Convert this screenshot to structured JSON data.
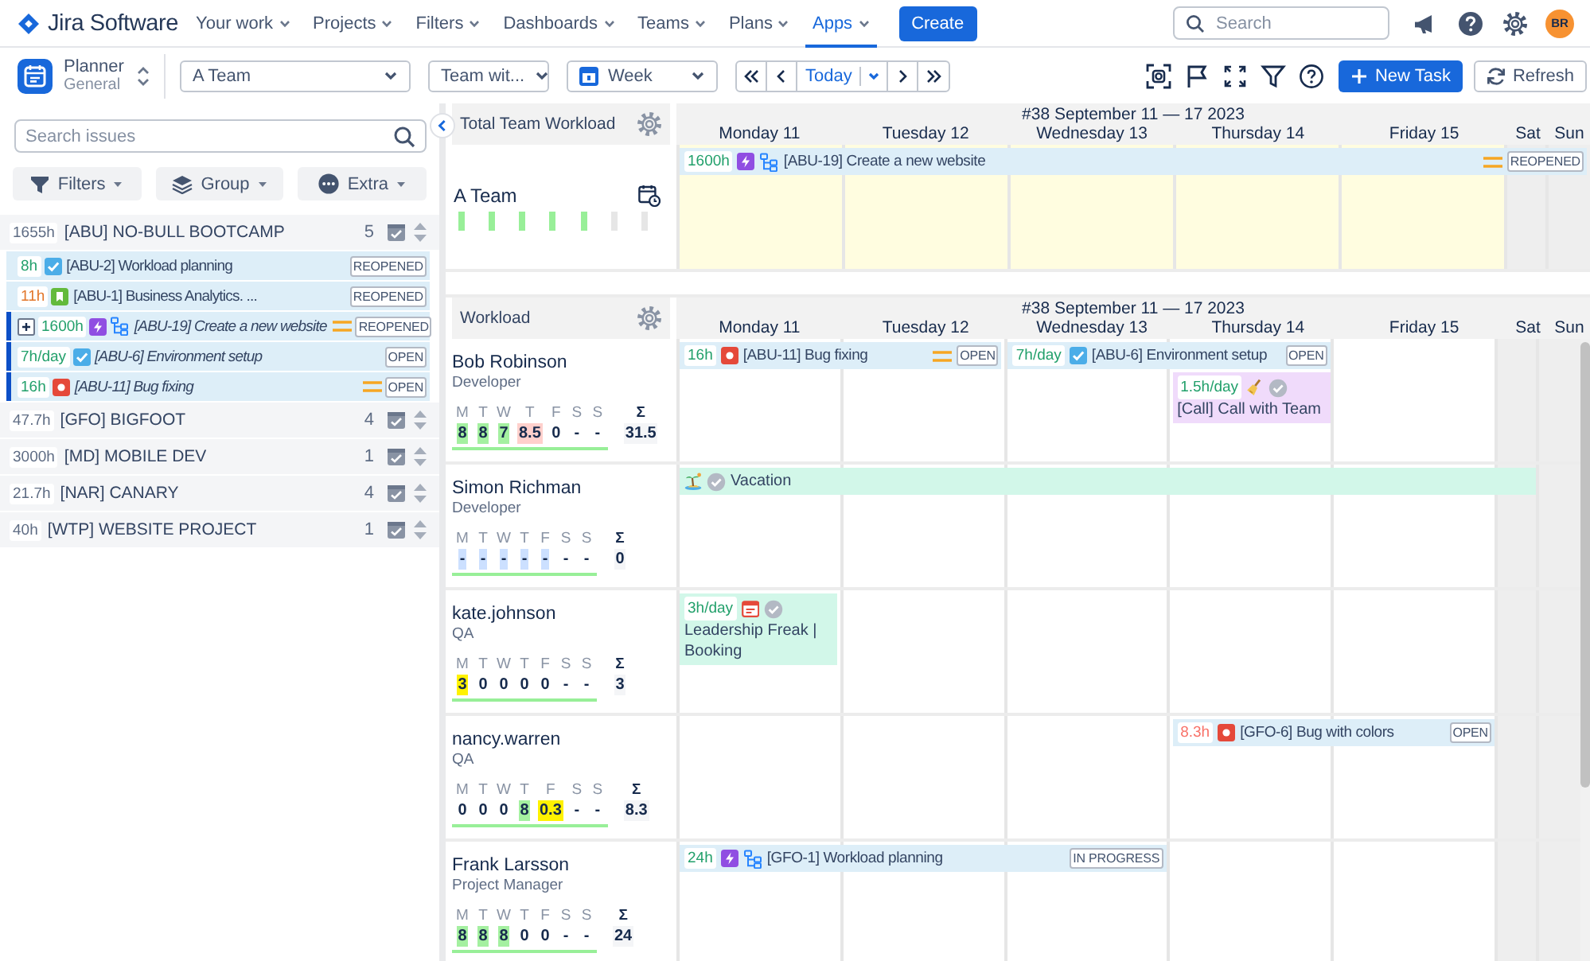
{
  "topnav": {
    "logo": "Jira Software",
    "items": [
      {
        "label": "Your work",
        "selected": false
      },
      {
        "label": "Projects",
        "selected": false
      },
      {
        "label": "Filters",
        "selected": false
      },
      {
        "label": "Dashboards",
        "selected": false
      },
      {
        "label": "Teams",
        "selected": false
      },
      {
        "label": "Plans",
        "selected": false
      },
      {
        "label": "Apps",
        "selected": true
      }
    ],
    "create": "Create",
    "search": {
      "placeholder": "Search"
    },
    "avatar": "BR"
  },
  "toolbar": {
    "app_title": "Planner",
    "app_subtitle": "General",
    "team_select": "A Team",
    "view_select": "Team wit...",
    "period_select": "Week",
    "today": "Today",
    "new_task": "New Task",
    "refresh": "Refresh"
  },
  "sidebar": {
    "search": {
      "placeholder": "Search issues"
    },
    "buttons": [
      {
        "label": "Filters",
        "kind": "filter"
      },
      {
        "label": "Group",
        "kind": "layers"
      },
      {
        "label": "Extra",
        "kind": "more"
      }
    ],
    "projects": [
      {
        "hours": "1655h",
        "name": "[ABU] NO-BULL BOOTCAMP",
        "count": "5",
        "children": [
          {
            "hours": "8h",
            "color": "#22a06b",
            "kind": "task",
            "title": "[ABU-2] Workload planning",
            "status": "REOPENED",
            "selected": false,
            "expandable": false,
            "subtasks": false,
            "prioritized": false
          },
          {
            "hours": "11h",
            "color": "#e2762a",
            "kind": "story",
            "title": "[ABU-1] Business Analytics. ...",
            "status": "REOPENED",
            "selected": false,
            "expandable": false,
            "subtasks": false,
            "prioritized": false
          },
          {
            "hours": "1600h",
            "color": "#22a06b",
            "kind": "epic",
            "title": "[ABU-19] Create a new website",
            "status": "REOPENED",
            "selected": true,
            "expandable": true,
            "subtasks": true,
            "prioritized": true
          },
          {
            "hours": "7h/day",
            "color": "#22a06b",
            "kind": "task",
            "title": "[ABU-6] Environment setup",
            "status": "OPEN",
            "selected": true,
            "expandable": false,
            "subtasks": false,
            "prioritized": false
          },
          {
            "hours": "16h",
            "color": "#22a06b",
            "kind": "bug",
            "title": "[ABU-11] Bug fixing",
            "status": "OPEN",
            "selected": true,
            "expandable": false,
            "subtasks": false,
            "prioritized": true
          }
        ]
      },
      {
        "hours": "47.7h",
        "name": "[GFO] BIGFOOT",
        "count": "4"
      },
      {
        "hours": "3000h",
        "name": "[MD] MOBILE DEV",
        "count": "1"
      },
      {
        "hours": "21.7h",
        "name": "[NAR] CANARY",
        "count": "4"
      },
      {
        "hours": "40h",
        "name": "[WTP] WEBSITE PROJECT",
        "count": "1"
      }
    ]
  },
  "team": {
    "header": "Total Team Workload",
    "week": "#38 September 11 — 17 2023",
    "days": [
      "Monday 11",
      "Tuesday 12",
      "Wednesday 13",
      "Thursday 14",
      "Friday 15",
      "Sat",
      "Sun"
    ],
    "name": "A Team",
    "bars": [
      {
        "color": "#98ef98"
      },
      {
        "color": "#98ef98"
      },
      {
        "color": "#98ef98"
      },
      {
        "color": "#98ef98"
      },
      {
        "color": "#98ef98"
      },
      {
        "color": "#e6e6e6"
      },
      {
        "color": "#e6e6e6"
      }
    ],
    "events": [
      {
        "kind": "epic",
        "covers": [
          true,
          true,
          true,
          true,
          true,
          true,
          true
        ],
        "hours": {
          "text": "1600h",
          "color": "#22a06b"
        },
        "subtasks": true,
        "title": "[ABU-19] Create a new website",
        "prioritized": true,
        "status": "REOPENED"
      }
    ]
  },
  "workload": {
    "header": "Workload",
    "week": "#38 September 11 — 17 2023",
    "days": [
      "Monday 11",
      "Tuesday 12",
      "Wednesday 13",
      "Thursday 14",
      "Friday 15",
      "Sat",
      "Sun"
    ],
    "people": [
      {
        "name": "Bob Robinson",
        "role": "Developer",
        "days": [
          {
            "letter": "M",
            "value": "8",
            "color": "#a4f0a0"
          },
          {
            "letter": "T",
            "value": "8",
            "color": "#a4f0a0"
          },
          {
            "letter": "W",
            "value": "7",
            "color": "#a4f0a0"
          },
          {
            "letter": "T",
            "value": "8.5",
            "color": "#ffd0cc"
          },
          {
            "letter": "F",
            "value": "0"
          },
          {
            "letter": "S",
            "value": "-"
          },
          {
            "letter": "S",
            "value": "-"
          }
        ],
        "total_label": "Σ",
        "total": "31.5",
        "events": [
          {
            "kind": "bug",
            "covers": [
              true,
              true,
              false,
              false,
              false,
              false,
              false
            ],
            "hours": {
              "text": "16h",
              "color": "#22a06b"
            },
            "subtasks": false,
            "title": "[ABU-11] Bug fixing",
            "prioritized": true,
            "status": "OPEN"
          },
          {
            "kind": "task",
            "covers": [
              false,
              false,
              true,
              true,
              false,
              false,
              false
            ],
            "hours": {
              "text": "7h/day",
              "color": "#22a06b"
            },
            "subtasks": false,
            "title": "[ABU-6] Environment setup",
            "prioritized": false,
            "status": "OPEN"
          },
          {
            "kind": "call",
            "covers": [
              false,
              false,
              false,
              true,
              false,
              false,
              false
            ],
            "hours": {
              "text": "1.5h/day",
              "color": "#22a06b"
            },
            "approved": true,
            "title": "[Call] Call with Team",
            "color": "#f0dbfb"
          }
        ]
      },
      {
        "name": "Simon Richman",
        "role": "Developer",
        "days": [
          {
            "letter": "M",
            "value": "-",
            "color": "#cce0ff"
          },
          {
            "letter": "T",
            "value": "-",
            "color": "#cce0ff"
          },
          {
            "letter": "W",
            "value": "-",
            "color": "#cce0ff"
          },
          {
            "letter": "T",
            "value": "-",
            "color": "#cce0ff"
          },
          {
            "letter": "F",
            "value": "-",
            "color": "#cce0ff"
          },
          {
            "letter": "S",
            "value": "-"
          },
          {
            "letter": "S",
            "value": "-"
          }
        ],
        "total_label": "Σ",
        "total": "0",
        "events": [
          {
            "kind": "vacation",
            "covers": [
              true,
              true,
              true,
              true,
              true,
              true,
              false
            ],
            "approved": true,
            "title": "Vacation",
            "color": "#d2f7e9"
          }
        ]
      },
      {
        "name": "kate.johnson",
        "role": "QA",
        "days": [
          {
            "letter": "M",
            "value": "3",
            "color": "#fff200"
          },
          {
            "letter": "T",
            "value": "0"
          },
          {
            "letter": "W",
            "value": "0"
          },
          {
            "letter": "T",
            "value": "0"
          },
          {
            "letter": "F",
            "value": "0"
          },
          {
            "letter": "S",
            "value": "-"
          },
          {
            "letter": "S",
            "value": "-"
          }
        ],
        "total_label": "Σ",
        "total": "3",
        "events": [
          {
            "kind": "meeting",
            "covers": [
              true,
              false,
              false,
              false,
              false,
              false,
              false
            ],
            "hours": {
              "text": "3h/day",
              "color": "#22a06b"
            },
            "approved": true,
            "title": "Leadership Freak | Booking",
            "color": "#d2f7e9"
          }
        ]
      },
      {
        "name": "nancy.warren",
        "role": "QA",
        "days": [
          {
            "letter": "M",
            "value": "0"
          },
          {
            "letter": "T",
            "value": "0"
          },
          {
            "letter": "W",
            "value": "0"
          },
          {
            "letter": "T",
            "value": "8",
            "color": "#a4f0a0"
          },
          {
            "letter": "F",
            "value": "0.3",
            "color": "#fff200"
          },
          {
            "letter": "S",
            "value": "-"
          },
          {
            "letter": "S",
            "value": "-"
          }
        ],
        "total_label": "Σ",
        "total": "8.3",
        "events": [
          {
            "kind": "bug",
            "covers": [
              false,
              false,
              false,
              true,
              true,
              false,
              false
            ],
            "hours": {
              "text": "8.3h",
              "color": "#f87168"
            },
            "subtasks": false,
            "title": "[GFO-6] Bug with colors",
            "prioritized": false,
            "status": "OPEN"
          }
        ]
      },
      {
        "name": "Frank Larsson",
        "role": "Project Manager",
        "days": [
          {
            "letter": "M",
            "value": "8",
            "color": "#a4f0a0"
          },
          {
            "letter": "T",
            "value": "8",
            "color": "#a4f0a0"
          },
          {
            "letter": "W",
            "value": "8",
            "color": "#a4f0a0"
          },
          {
            "letter": "T",
            "value": "0"
          },
          {
            "letter": "F",
            "value": "0"
          },
          {
            "letter": "S",
            "value": "-"
          },
          {
            "letter": "S",
            "value": "-"
          }
        ],
        "total_label": "Σ",
        "total": "24",
        "events": [
          {
            "kind": "epic",
            "covers": [
              true,
              true,
              true,
              false,
              false,
              false,
              false
            ],
            "hours": {
              "text": "24h",
              "color": "#22a06b"
            },
            "subtasks": true,
            "title": "[GFO-1] Workload planning",
            "prioritized": false,
            "status": "IN PROGRESS"
          }
        ]
      }
    ]
  }
}
